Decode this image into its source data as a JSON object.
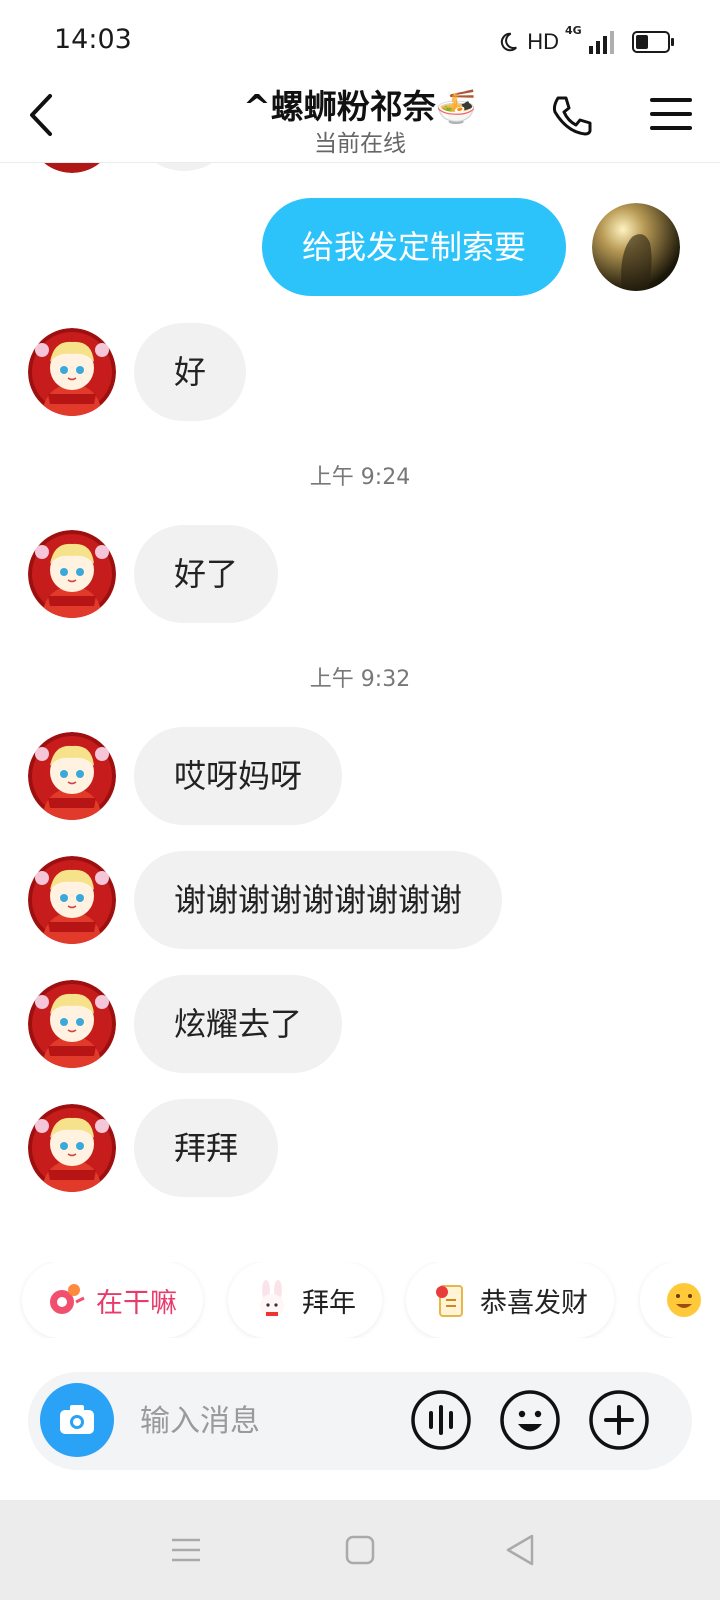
{
  "status_bar": {
    "time": "14:03",
    "network_label": "HD",
    "signal_label": "4G",
    "battery_fraction": 0.4
  },
  "header": {
    "title": "^螺蛳粉祁奈🍜",
    "subtitle": "当前在线"
  },
  "messages": [
    {
      "from": "me",
      "text": "给我发定制索要"
    },
    {
      "from": "other",
      "text": "好"
    },
    {
      "time": "上午 9:24"
    },
    {
      "from": "other",
      "text": "好了"
    },
    {
      "time": "上午 9:32"
    },
    {
      "from": "other",
      "text": "哎呀妈呀"
    },
    {
      "from": "other",
      "text": "谢谢谢谢谢谢谢谢谢"
    },
    {
      "from": "other",
      "text": "炫耀去了"
    },
    {
      "from": "other",
      "text": "拜拜"
    }
  ],
  "quick_chips": [
    {
      "label": "在干嘛",
      "icon": "wave-icon",
      "color": "#e83b6b"
    },
    {
      "label": "拜年",
      "icon": "rabbit-icon",
      "color": "#222222"
    },
    {
      "label": "恭喜发财",
      "icon": "fortune-icon",
      "color": "#222222"
    },
    {
      "label": "",
      "icon": "hug-emoji-icon",
      "color": "#222222"
    }
  ],
  "input": {
    "placeholder": "输入消息"
  },
  "colors": {
    "accent": "#2cc3fb",
    "camera": "#2aa2f5",
    "bubble_other": "#f1f1f1"
  }
}
